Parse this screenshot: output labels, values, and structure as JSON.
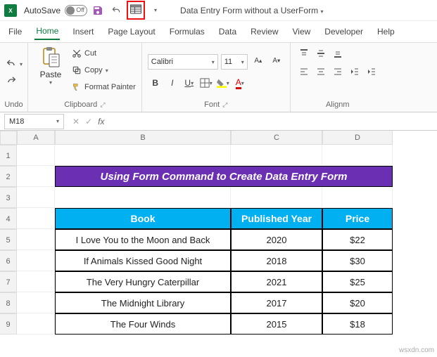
{
  "titlebar": {
    "autosave_label": "AutoSave",
    "autosave_state": "Off",
    "doc_name": "Data Entry Form without a UserForm"
  },
  "tabs": [
    "File",
    "Home",
    "Insert",
    "Page Layout",
    "Formulas",
    "Data",
    "Review",
    "View",
    "Developer",
    "Help"
  ],
  "active_tab": "Home",
  "ribbon": {
    "undo_label": "Undo",
    "paste_label": "Paste",
    "cut_label": "Cut",
    "copy_label": "Copy",
    "format_painter_label": "Format Painter",
    "clipboard_label": "Clipboard",
    "font_name": "Calibri",
    "font_size": "11",
    "font_label": "Font",
    "alignment_label": "Alignm"
  },
  "name_box": "M18",
  "columns": [
    "A",
    "B",
    "C",
    "D"
  ],
  "rows": [
    "1",
    "2",
    "3",
    "4",
    "5",
    "6",
    "7",
    "8",
    "9"
  ],
  "sheet": {
    "title": "Using Form Command to Create Data Entry Form",
    "headers": [
      "Book",
      "Published Year",
      "Price"
    ],
    "data": [
      [
        "I Love You to the Moon and Back",
        "2020",
        "$22"
      ],
      [
        "If Animals Kissed Good Night",
        "2018",
        "$30"
      ],
      [
        "The Very Hungry Caterpillar",
        "2021",
        "$25"
      ],
      [
        "The Midnight Library",
        "2017",
        "$20"
      ],
      [
        "The Four Winds",
        "2015",
        "$18"
      ]
    ]
  },
  "watermark": "wsxdn.com"
}
